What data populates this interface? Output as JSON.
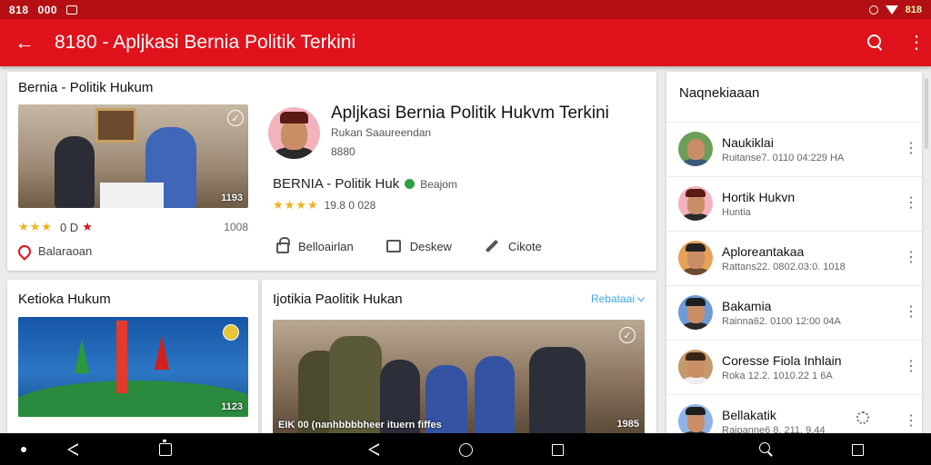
{
  "status_bar": {
    "time": "818",
    "extra": "000",
    "battery": "818"
  },
  "app_bar": {
    "back_glyph": "←",
    "title": "8180 - Apljkasi Bernia Politik Terkini",
    "menu_glyph": "⋮"
  },
  "featured": {
    "section_label": "Bernia - Politik Hukum",
    "duration": "1193",
    "stars": "★★★",
    "rating_text": "0 D",
    "red_star": "★",
    "count": "1008",
    "source_label": "Balaraoan",
    "channel": {
      "title": "Apljkasi Bernia Politik Hukvm Terkini",
      "subtitle": "Rukan Saaureendan",
      "number": "8880",
      "name": "BERNIA - Politik Huk",
      "tag": "Beajom",
      "stars": "★★★★",
      "rating_value": "19.8 0 028"
    },
    "actions": [
      {
        "label": "Belloairlan"
      },
      {
        "label": "Deskew"
      },
      {
        "label": "Cikote"
      }
    ]
  },
  "card_b": {
    "label": "Ketioka Hukum",
    "duration": "1123"
  },
  "card_c": {
    "label": "Ijotikia Paolitik Hukan",
    "more_label": "Rebataai",
    "caption": "EIK 00 (nanhbbbbheer  ituern fiffes",
    "duration": "1985"
  },
  "sidebar": {
    "header": "Naqnekiaaan",
    "items": [
      {
        "name": "Naukiklai",
        "sub": "Ruitanse7. 0110 04:229 HA"
      },
      {
        "name": "Hortik Hukvn",
        "sub": "Huntia"
      },
      {
        "name": "Aploreantakaa",
        "sub": "Rattans22. 0802.03:0. 1018"
      },
      {
        "name": "Bakamia",
        "sub": "Rainna62. 0100 12:00 04A"
      },
      {
        "name": "Coresse Fiola Inhlain",
        "sub": "Roka 12.2. 1010.22 1 6A"
      },
      {
        "name": "Bellakatik",
        "sub": "Raipanne6 8. 211. 9.44"
      }
    ],
    "more_glyph": "⋮"
  },
  "colors": {
    "primary": "#e0121c",
    "status": "#b40f12",
    "accent": "#3da8e6",
    "star": "#f2b01e"
  }
}
